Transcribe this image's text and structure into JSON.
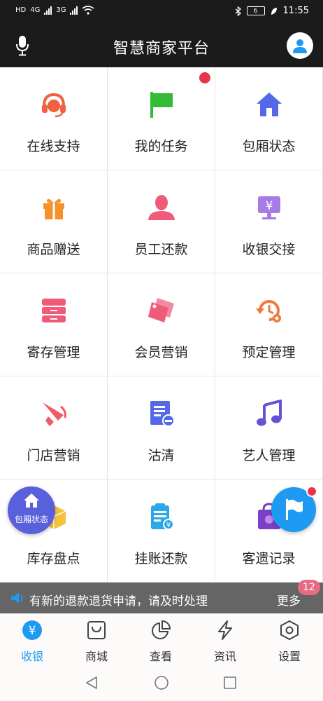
{
  "status_bar": {
    "left_text": "HD",
    "net_4g": "4G",
    "net_3g": "3G",
    "battery": "6",
    "time": "11:55"
  },
  "header": {
    "title": "智慧商家平台"
  },
  "grid_items": [
    {
      "label": "在线支持",
      "icon": "headset-icon",
      "color": "#f1603f"
    },
    {
      "label": "我的任务",
      "icon": "flag-icon",
      "color": "#33bb33",
      "badge": true
    },
    {
      "label": "包厢状态",
      "icon": "home-icon",
      "color": "#5468e8"
    },
    {
      "label": "商品赠送",
      "icon": "gift-icon",
      "color": "#f5922b"
    },
    {
      "label": "员工还款",
      "icon": "person-icon",
      "color": "#f05b7a"
    },
    {
      "label": "收银交接",
      "icon": "cashier-monitor-icon",
      "color": "#a77ae8"
    },
    {
      "label": "寄存管理",
      "icon": "drawer-icon",
      "color": "#f05b7a"
    },
    {
      "label": "会员营销",
      "icon": "tag-icon",
      "color": "#f05b7a"
    },
    {
      "label": "预定管理",
      "icon": "clock-history-icon",
      "color": "#f07a3a"
    },
    {
      "label": "门店营销",
      "icon": "megaphone-icon",
      "color": "#f05b65"
    },
    {
      "label": "沽清",
      "icon": "list-minus-icon",
      "color": "#5468e8"
    },
    {
      "label": "艺人管理",
      "icon": "music-icon",
      "color": "#6a4fd6"
    },
    {
      "label": "库存盘点",
      "icon": "box-icon",
      "color": "#f5c33b"
    },
    {
      "label": "挂账还款",
      "icon": "clipboard-yen-icon",
      "color": "#29a9e8"
    },
    {
      "label": "客遗记录",
      "icon": "bag-icon",
      "color": "#7b3fc8"
    }
  ],
  "notice": {
    "text": "有新的退款退货申请，请及时处理",
    "more": "更多",
    "badge": "12"
  },
  "fab_left": {
    "label": "包厢状态"
  },
  "tabs": [
    {
      "label": "收银",
      "icon": "yen-circle-icon",
      "active": true
    },
    {
      "label": "商城",
      "icon": "shopping-bag-icon",
      "active": false
    },
    {
      "label": "查看",
      "icon": "pie-chart-icon",
      "active": false
    },
    {
      "label": "资讯",
      "icon": "lightning-icon",
      "active": false
    },
    {
      "label": "设置",
      "icon": "hexagon-settings-icon",
      "active": false
    }
  ],
  "colors": {
    "accent": "#1e9af2",
    "header_bg": "#1b1b1b",
    "fab_left_bg": "#5a5fdc",
    "badge_red": "#e8344a"
  }
}
